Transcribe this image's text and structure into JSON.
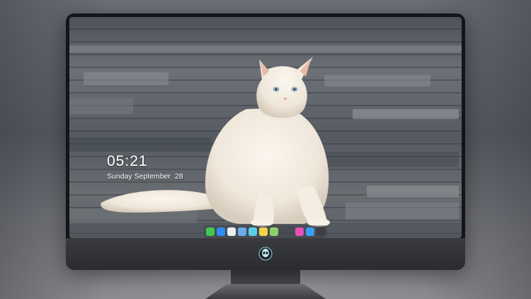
{
  "clock": {
    "time": "05:21",
    "date": "Sunday September  28"
  },
  "wallpaper": {
    "subject": "white-cat-on-stone-pavement-icon"
  },
  "dock": {
    "apps_left": [
      {
        "icon": "messages-icon",
        "color": "#3ec94e"
      },
      {
        "icon": "finder-icon",
        "color": "#2f8cf0"
      },
      {
        "icon": "safari-compass-icon",
        "color": "#e9eef3"
      },
      {
        "icon": "preview-icon",
        "color": "#6aaee8"
      },
      {
        "icon": "clapper-icon",
        "color": "#5ad0e6"
      },
      {
        "icon": "notes-icon",
        "color": "#f6d24a"
      },
      {
        "icon": "photos-icon",
        "color": "#8fcf6a"
      }
    ],
    "apps_right": [
      {
        "icon": "music-icon",
        "color": "#e94fb8"
      },
      {
        "icon": "app-store-icon",
        "color": "#3aa0f5"
      },
      {
        "icon": "camera-icon",
        "color": "#3d3f45"
      }
    ]
  },
  "monitor": {
    "logo": "alien-logo-icon"
  }
}
